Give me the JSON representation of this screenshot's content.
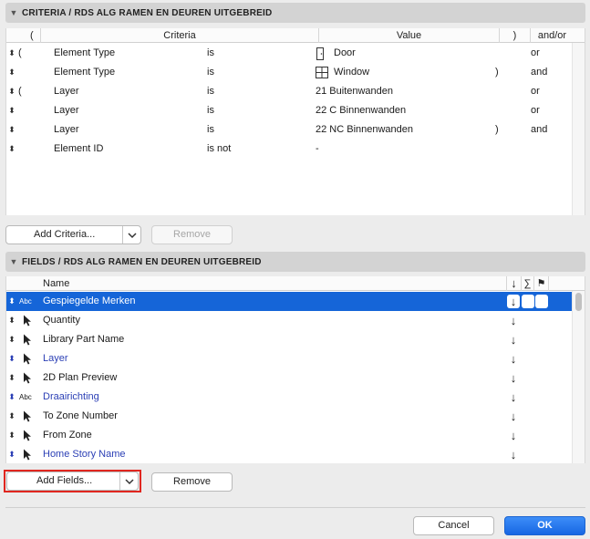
{
  "criteria": {
    "header": "CRITERIA / RDS ALG RAMEN EN DEUREN UITGEBREID",
    "columns": {
      "open": "(",
      "criteria": "Criteria",
      "value": "Value",
      "close": ")",
      "andor": "and/or"
    },
    "rows": [
      {
        "open": "(",
        "element": "Element Type",
        "op": "is",
        "value": "Door",
        "icon": "door-icon",
        "close": "",
        "andor": "or"
      },
      {
        "open": "",
        "element": "Element Type",
        "op": "is",
        "value": "Window",
        "icon": "window-icon",
        "close": ")",
        "andor": "and"
      },
      {
        "open": "(",
        "element": "Layer",
        "op": "is",
        "value": "21 Buitenwanden",
        "icon": "",
        "close": "",
        "andor": "or"
      },
      {
        "open": "",
        "element": "Layer",
        "op": "is",
        "value": "22 C Binnenwanden",
        "icon": "",
        "close": "",
        "andor": "or"
      },
      {
        "open": "",
        "element": "Layer",
        "op": "is",
        "value": "22 NC Binnenwanden",
        "icon": "",
        "close": ")",
        "andor": "and"
      },
      {
        "open": "",
        "element": "Element ID",
        "op": "is not",
        "value": "-",
        "icon": "",
        "close": "",
        "andor": ""
      }
    ],
    "add_label": "Add Criteria...",
    "remove_label": "Remove"
  },
  "fields": {
    "header": "FIELDS / RDS ALG RAMEN EN DEUREN UITGEBREID",
    "columns": {
      "name": "Name",
      "sort": "↓",
      "sum": "∑",
      "flag": "⚑"
    },
    "rows": [
      {
        "name": "Gespiegelde Merken",
        "icon": "abc-icon",
        "blue": false,
        "selected": true
      },
      {
        "name": "Quantity",
        "icon": "pointer-icon",
        "blue": false,
        "selected": false
      },
      {
        "name": "Library Part Name",
        "icon": "pointer-icon",
        "blue": false,
        "selected": false
      },
      {
        "name": "Layer",
        "icon": "pointer-icon",
        "blue": true,
        "selected": false
      },
      {
        "name": "2D Plan Preview",
        "icon": "pointer-icon",
        "blue": false,
        "selected": false
      },
      {
        "name": "Draairichting",
        "icon": "abc-icon",
        "blue": true,
        "selected": false
      },
      {
        "name": "To Zone Number",
        "icon": "pointer-icon",
        "blue": false,
        "selected": false
      },
      {
        "name": "From Zone",
        "icon": "pointer-icon",
        "blue": false,
        "selected": false
      },
      {
        "name": "Home Story Name",
        "icon": "pointer-icon",
        "blue": true,
        "selected": false
      }
    ],
    "add_label": "Add Fields...",
    "remove_label": "Remove"
  },
  "abc_text": "Abc",
  "dialog": {
    "cancel_label": "Cancel",
    "ok_label": "OK"
  },
  "colors": {
    "accent": "#1565d8",
    "highlight": "#e0261f",
    "link_blue": "#2b3fb5"
  }
}
